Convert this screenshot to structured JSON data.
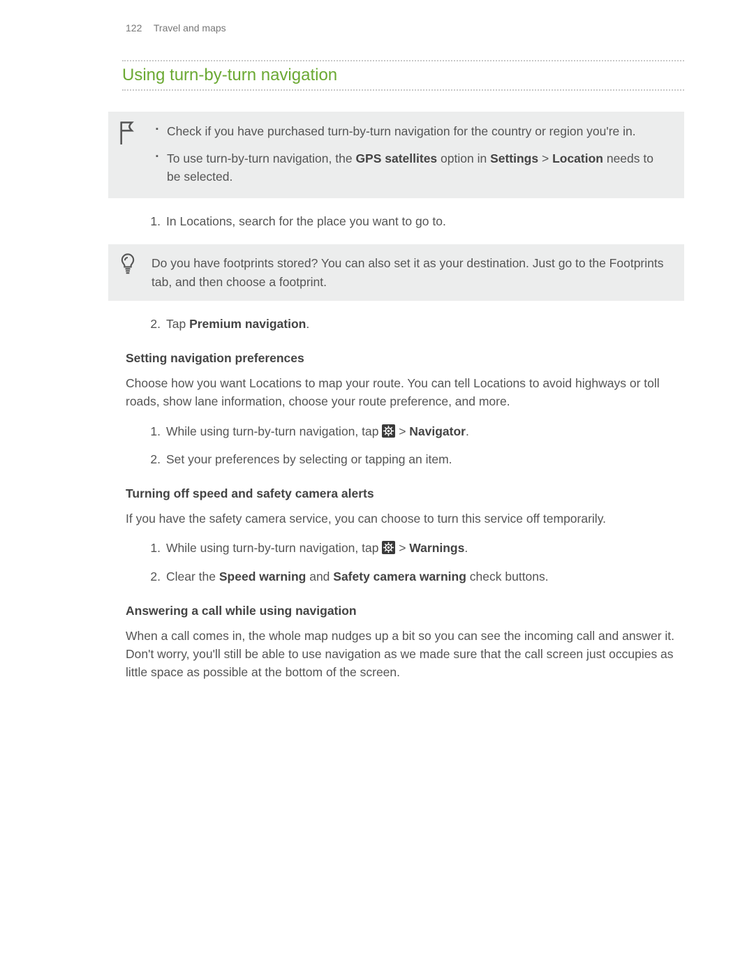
{
  "header": {
    "page_number": "122",
    "chapter": "Travel and maps"
  },
  "section_title": "Using turn-by-turn navigation",
  "requirements": {
    "item1": "Check if you have purchased turn-by-turn navigation for the country or region you're in.",
    "item2_a": "To use turn-by-turn navigation, the ",
    "item2_bold1": "GPS satellites",
    "item2_b": " option in ",
    "item2_bold2": "Settings",
    "item2_c": " > ",
    "item2_bold3": "Location",
    "item2_d": " needs to be selected."
  },
  "steps_a": {
    "s1_num": "1.",
    "s1_text": "In Locations, search for the place you want to go to."
  },
  "tip": {
    "text": "Do you have footprints stored? You can also set it as your destination. Just go to the Footprints tab, and then choose a footprint."
  },
  "steps_b": {
    "s2_num": "2.",
    "s2_a": "Tap ",
    "s2_bold": "Premium navigation",
    "s2_b": "."
  },
  "prefs": {
    "heading": "Setting navigation preferences",
    "para": "Choose how you want Locations to map your route. You can tell Locations to avoid highways or toll roads, show lane information, choose your route preference, and more.",
    "s1_num": "1.",
    "s1_a": "While using turn-by-turn navigation, tap ",
    "s1_b": " > ",
    "s1_bold": "Navigator",
    "s1_c": ".",
    "s2_num": "2.",
    "s2_text": "Set your preferences by selecting or tapping an item."
  },
  "alerts": {
    "heading": "Turning off speed and safety camera alerts",
    "para": "If you have the safety camera service, you can choose to turn this service off temporarily.",
    "s1_num": "1.",
    "s1_a": "While using turn-by-turn navigation, tap ",
    "s1_b": " > ",
    "s1_bold": "Warnings",
    "s1_c": ".",
    "s2_num": "2.",
    "s2_a": "Clear the ",
    "s2_bold1": "Speed warning",
    "s2_b": " and ",
    "s2_bold2": "Safety camera warning",
    "s2_c": " check buttons."
  },
  "call": {
    "heading": "Answering a call while using navigation",
    "para": "When a call comes in, the whole map nudges up a bit so you can see the incoming call and answer it. Don't worry, you'll still be able to use navigation as we made sure that the call screen just occupies as little space as possible at the bottom of the screen."
  }
}
